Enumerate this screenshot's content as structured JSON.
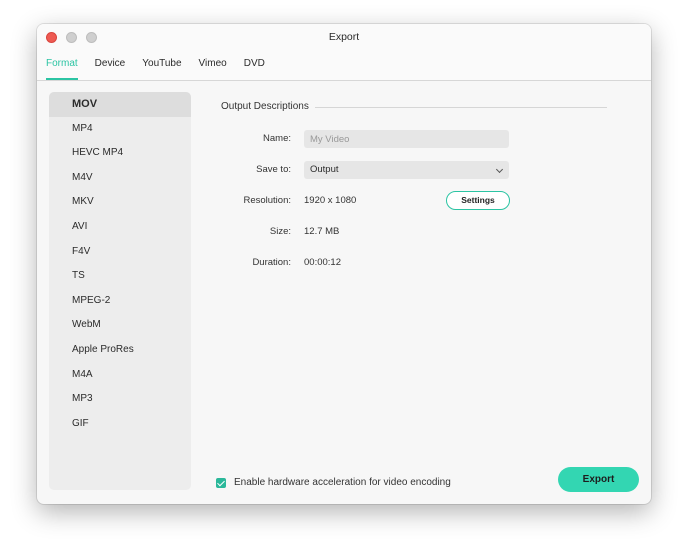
{
  "window": {
    "title": "Export"
  },
  "tabs": [
    {
      "label": "Format",
      "active": true
    },
    {
      "label": "Device"
    },
    {
      "label": "YouTube"
    },
    {
      "label": "Vimeo"
    },
    {
      "label": "DVD"
    }
  ],
  "formats": {
    "selected": "MOV",
    "items": [
      "MOV",
      "MP4",
      "HEVC MP4",
      "M4V",
      "MKV",
      "AVI",
      "F4V",
      "TS",
      "MPEG-2",
      "WebM",
      "Apple ProRes",
      "M4A",
      "MP3",
      "GIF"
    ]
  },
  "output": {
    "section_title": "Output Descriptions",
    "name_label": "Name:",
    "name_placeholder": "My Video",
    "save_to_label": "Save to:",
    "save_to_value": "Output",
    "resolution_label": "Resolution:",
    "resolution_value": "1920 x 1080",
    "settings_label": "Settings",
    "size_label": "Size:",
    "size_value": "12.7 MB",
    "duration_label": "Duration:",
    "duration_value": "00:00:12"
  },
  "hardware_accel": {
    "label": "Enable hardware acceleration for video encoding",
    "checked": true
  },
  "export_label": "Export",
  "colors": {
    "accent": "#2bc4a3",
    "export_button": "#33d6b2",
    "close": "#ee5a52"
  }
}
